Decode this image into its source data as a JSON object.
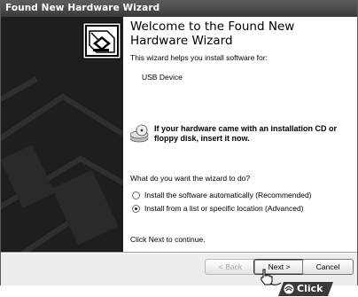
{
  "window": {
    "title": "Found New Hardware Wizard"
  },
  "content": {
    "heading": "Welcome to the Found New Hardware Wizard",
    "intro": "This wizard helps you install software for:",
    "device": "USB Device",
    "cd_notice": "If your hardware came with an installation CD or floppy disk, insert it now.",
    "question": "What do you want the wizard to do?",
    "options": [
      {
        "label": "Install the software automatically (Recommended)",
        "selected": false
      },
      {
        "label": "Install from a list or specific location (Advanced)",
        "selected": true
      }
    ],
    "continue_hint": "Click Next to continue."
  },
  "footer": {
    "back_label": "< Back",
    "next_label": "Next >",
    "cancel_label": "Cancel"
  },
  "annotation": {
    "click_label": "Click"
  },
  "icons": {
    "wizard_graphic": "hardware-card-icon",
    "cd_notice": "cd-drive-icon",
    "cursor": "hand-cursor-icon"
  }
}
